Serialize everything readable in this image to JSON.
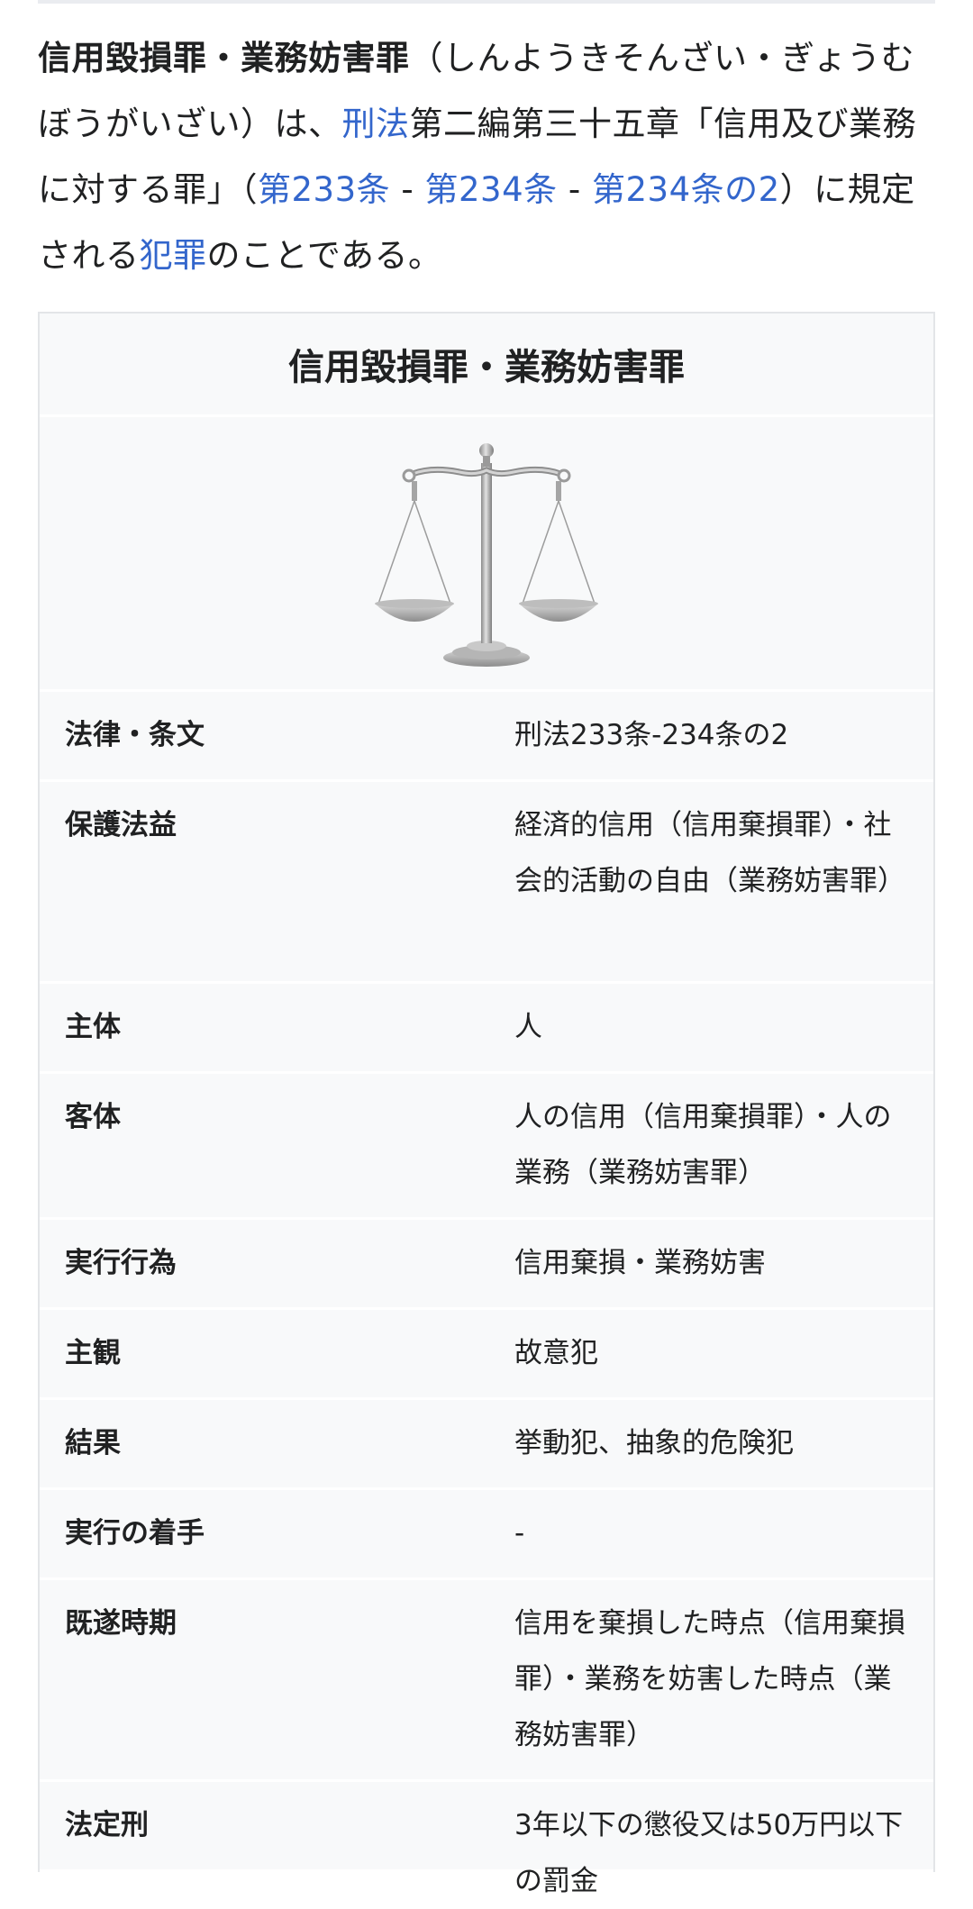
{
  "intro": {
    "bold_term": "信用毀損罪・業務妨害罪",
    "reading": "（しんようきそんざい・ぎょうむぼうがいざい）は、",
    "link_keiho": "刑法",
    "text_2": "第二編第三十五章「信用及び業務に対する罪」（",
    "link_233": "第233条",
    "sep1": " - ",
    "link_234": "第234条",
    "sep2": " - ",
    "link_234_2": "第234条の2",
    "text_3": "）に規定される",
    "link_hanzai": "犯罪",
    "text_4": "のことである。"
  },
  "infobox": {
    "title": "信用毀損罪・業務妨害罪",
    "image_icon": "scales-of-justice-icon",
    "rows": [
      {
        "label": "法律・条文",
        "value": "刑法233条-234条の2"
      },
      {
        "label": "保護法益",
        "value": "経済的信用（信用棄損罪）・社会的活動の自由（業務妨害罪）"
      },
      {
        "label": "主体",
        "value": "人"
      },
      {
        "label": "客体",
        "value": "人の信用（信用棄損罪）・人の業務（業務妨害罪）"
      },
      {
        "label": "実行行為",
        "value": "信用棄損・業務妨害"
      },
      {
        "label": "主観",
        "value": "故意犯"
      },
      {
        "label": "結果",
        "value": "挙動犯、抽象的危険犯"
      },
      {
        "label": "実行の着手",
        "value": "-"
      },
      {
        "label": "既遂時期",
        "value": "信用を棄損した時点（信用棄損罪）・業務を妨害した時点（業務妨害罪）"
      },
      {
        "label": "法定刑",
        "value": "3年以下の懲役又は50万円以下の罰金"
      }
    ]
  },
  "colors": {
    "link": "#3366cc",
    "text": "#202122",
    "infobox_bg": "#f8f9fa"
  }
}
